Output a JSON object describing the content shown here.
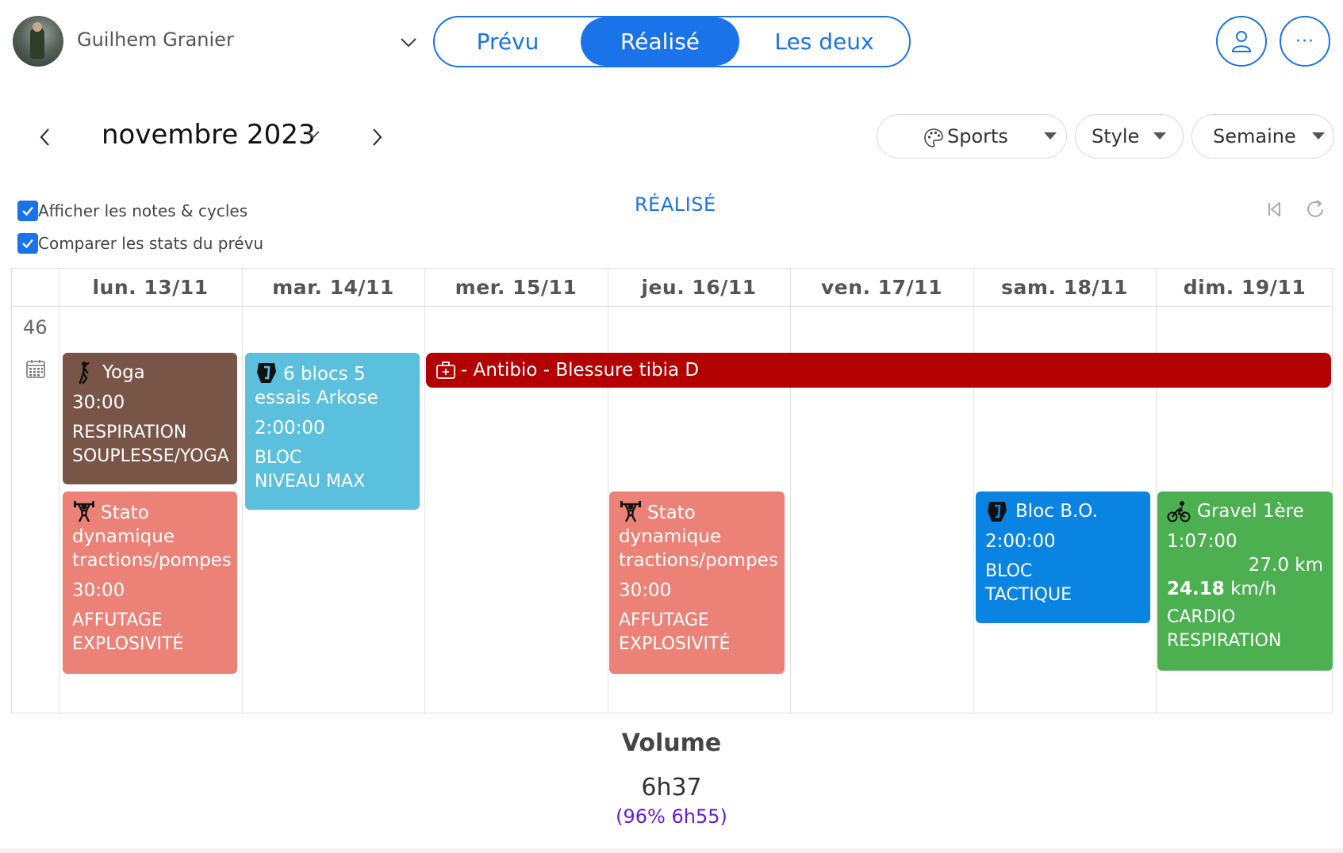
{
  "user": {
    "name": "Guilhem Granier"
  },
  "segment": {
    "items": [
      "Prévu",
      "Réalisé",
      "Les deux"
    ],
    "selected": "Réalisé"
  },
  "navigation": {
    "month": "novembre 2023"
  },
  "filters": {
    "sports": "Sports",
    "style": "Style",
    "period": "Semaine"
  },
  "checks": {
    "notes": "Afficher les notes & cycles",
    "compare": "Comparer les stats du prévu"
  },
  "view_title": "RÉALISÉ",
  "calendar": {
    "week_number": "46",
    "days": [
      "lun. 13/11",
      "mar. 14/11",
      "mer. 15/11",
      "jeu. 16/11",
      "ven. 17/11",
      "sam. 18/11",
      "dim. 19/11"
    ]
  },
  "events": {
    "yoga": {
      "title": "Yoga",
      "duration": "30:00",
      "tag": "RESPIRATION\nSOUPLESSE/YOGA",
      "color": "#795548",
      "icon": "yoga-icon"
    },
    "stato1": {
      "title": "Stato dynamique tractions/pompes",
      "duration": "30:00",
      "tag": "AFFUTAGE\nEXPLOSIVITÉ",
      "color": "#ec8277",
      "icon": "weightlifting-icon"
    },
    "bloc6": {
      "title": "6 blocs 5 essais Arkose",
      "duration": "2:00:00",
      "tag": "BLOC\nNIVEAU MAX",
      "color": "#5bc0de",
      "icon": "climbing-icon"
    },
    "antibio": {
      "title": "- Antibio - Blessure tibia D",
      "color": "#b30000",
      "icon": "medical-kit-icon"
    },
    "stato2": {
      "title": "Stato dynamique tractions/pompes",
      "duration": "30:00",
      "tag": "AFFUTAGE\nEXPLOSIVITÉ",
      "color": "#ec8277",
      "icon": "weightlifting-icon"
    },
    "blocbo": {
      "title": "Bloc B.O.",
      "duration": "2:00:00",
      "tag": "BLOC\nTACTIQUE",
      "color": "#0a84e3",
      "icon": "climbing-icon"
    },
    "gravel": {
      "title": "Gravel 1ère",
      "duration": "1:07:00",
      "distance": "27.0 km",
      "speed_value": "24.18",
      "speed_unit": "km/h",
      "tag": "CARDIO\nRESPIRATION",
      "color": "#4caf50",
      "icon": "cycling-icon"
    }
  },
  "volume": {
    "label": "Volume",
    "value": "6h37",
    "comparison": "(96% 6h55)"
  },
  "colors": {
    "accent": "#1a73e8",
    "comparison": "#6a1bd6"
  }
}
